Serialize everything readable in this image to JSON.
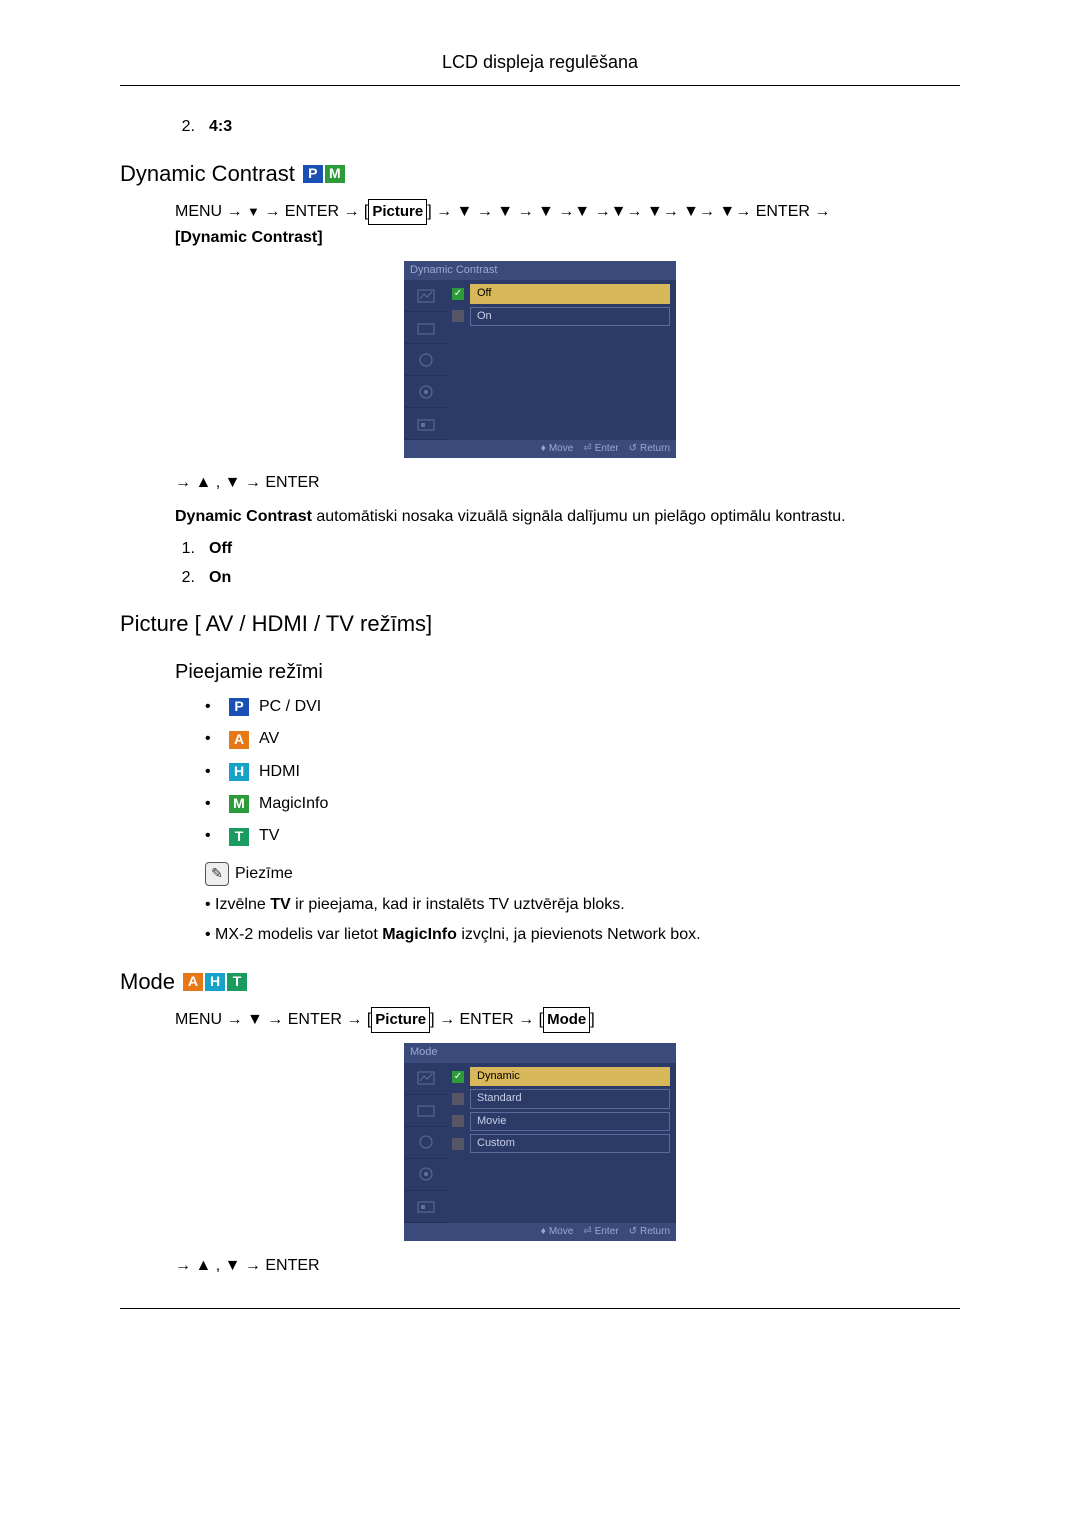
{
  "header": {
    "title": "LCD displeja regulēšana"
  },
  "top_num_item": {
    "n": "2.",
    "text": "4:3"
  },
  "section_dc": {
    "title": "Dynamic Contrast",
    "badges": [
      "P",
      "M"
    ],
    "nav1_pre": "MENU → ",
    "nav1_enter1": " → ENTER → ",
    "nav1_picture": "Picture",
    "nav1_mid_arrows": " → ▼ → ▼ → ▼ →▼ →▼→ ▼→ ▼→ ▼→ ENTER → ",
    "nav1_end": "[Dynamic Contrast]",
    "osd_title": "Dynamic Contrast",
    "osd_options": [
      {
        "label": "Off",
        "selected": true
      },
      {
        "label": "On",
        "selected": false
      }
    ],
    "osd_foot": {
      "move": "Move",
      "enter": "Enter",
      "return": "Return"
    },
    "nav2": "→ ▲ , ▼ → ENTER",
    "description": "Dynamic Contrast automātiski nosaka vizuālā signāla dalījumu un pielāgo optimālu kontrastu.",
    "list": [
      {
        "n": "1.",
        "text": "Off"
      },
      {
        "n": "2.",
        "text": "On"
      }
    ]
  },
  "section_picture": {
    "title": "Picture [ AV / HDMI / TV režīms]",
    "subheading": "Pieejamie režīmi",
    "modes": [
      {
        "badge": "P",
        "label": "PC / DVI"
      },
      {
        "badge": "A",
        "label": "AV"
      },
      {
        "badge": "H",
        "label": "HDMI"
      },
      {
        "badge": "M",
        "label": "MagicInfo"
      },
      {
        "badge": "T",
        "label": "TV"
      }
    ],
    "note_label": "Piezīme",
    "notes": [
      "Izvēlne TV ir pieejama, kad ir instalēts TV uztvērēja bloks.",
      "MX-2 modelis var lietot MagicInfo izvēlni, ja pievienots Network box."
    ],
    "note_bold_tv": "TV",
    "note_bold_mi": "MagicInfo"
  },
  "section_mode": {
    "title": "Mode",
    "badges": [
      "A",
      "H",
      "T"
    ],
    "nav1_pre": "MENU → ▼ → ENTER → ",
    "nav1_picture": "Picture",
    "nav1_mid": " → ENTER → ",
    "nav1_mode": "Mode",
    "osd_title": "Mode",
    "osd_options": [
      {
        "label": "Dynamic",
        "selected": true
      },
      {
        "label": "Standard",
        "selected": false
      },
      {
        "label": "Movie",
        "selected": false
      },
      {
        "label": "Custom",
        "selected": false
      }
    ],
    "osd_foot": {
      "move": "Move",
      "enter": "Enter",
      "return": "Return"
    },
    "nav2": "→ ▲ , ▼ → ENTER"
  }
}
